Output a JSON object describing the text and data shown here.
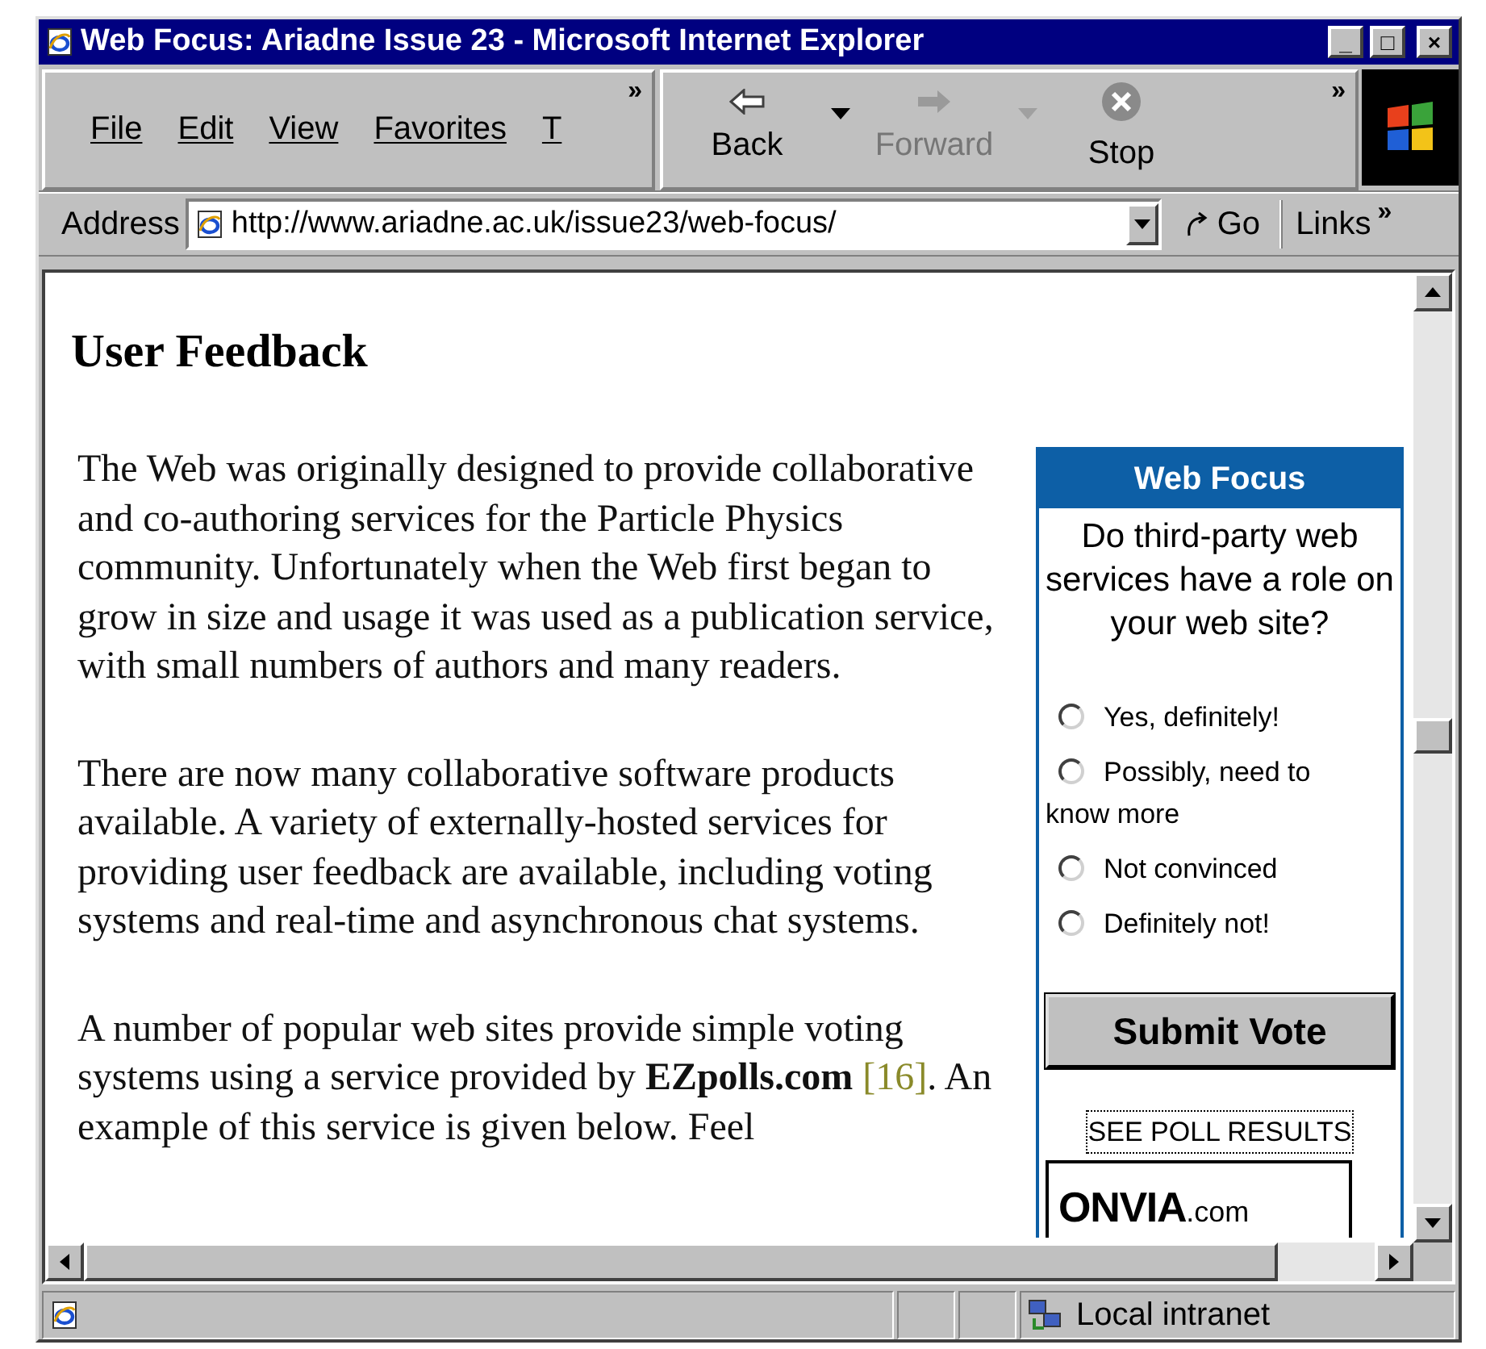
{
  "window": {
    "title": "Web Focus: Ariadne Issue 23 - Microsoft Internet Explorer",
    "controls": [
      "_",
      "□",
      "×"
    ]
  },
  "menu": [
    "File",
    "Edit",
    "View",
    "Favorites",
    "T"
  ],
  "menu_overflow": "»",
  "toolbar": [
    {
      "label": "Back",
      "kind": "back",
      "disabled": false
    },
    {
      "label": "Forward",
      "kind": "forward",
      "disabled": true
    },
    {
      "label": "Stop",
      "kind": "stop",
      "disabled": false
    }
  ],
  "toolbar_overflow": "»",
  "address": {
    "label": "Address",
    "value": "http://www.ariadne.ac.uk/issue23/web-focus/",
    "go": "Go",
    "links": "Links",
    "links_overflow": "»"
  },
  "article": {
    "heading": "User Feedback",
    "paragraphs": [
      {
        "text": "The Web was originally designed to provide collaborative and co-authoring services for the Particle Physics community. Unfortunately when the Web first began to grow in size and usage it was used as a publication service, with small numbers of authors and many readers."
      },
      {
        "text": "There are now many collaborative software products available. A variety of externally-hosted services for providing user feedback are available, including voting systems and real-time and asynchronous chat systems."
      },
      {
        "text": "A number of popular web sites provide simple voting systems using a service provided by **EZpolls.com**",
        "link": "[16]",
        "after": ". An example of this service is given below. Feel"
      }
    ]
  },
  "poll": {
    "title": "Web Focus",
    "question": "Do third-party web services have a role on your web site?",
    "options": [
      {
        "label": "Yes, definitely!",
        "selected": false
      },
      {
        "label": "Possibly, need to know more",
        "selected": false
      },
      {
        "label": "Not convinced",
        "selected": false
      },
      {
        "label": "Definitely not!",
        "selected": false
      }
    ],
    "submit": "Submit Vote",
    "results": "SEE POLL RESULTS",
    "logo": "ONVIA",
    "logo_suffix": ".com"
  },
  "status_bar": {
    "zone": "Local intranet"
  }
}
